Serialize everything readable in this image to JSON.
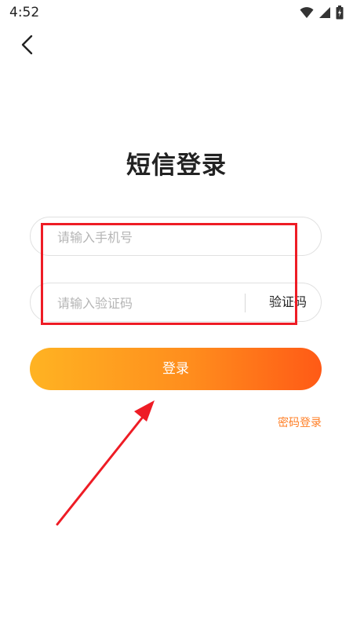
{
  "status_bar": {
    "time": "4:52",
    "icons": [
      "wifi-icon",
      "signal-icon",
      "battery-icon"
    ]
  },
  "header": {
    "back_icon": "chevron-left-icon"
  },
  "page": {
    "title": "短信登录"
  },
  "form": {
    "phone_placeholder": "请输入手机号",
    "phone_value": "",
    "code_placeholder": "请输入验证码",
    "code_value": "",
    "code_button_label": "验证码",
    "submit_label": "登录"
  },
  "links": {
    "password_login": "密码登录"
  },
  "colors": {
    "accent_start": "#ffb322",
    "accent_end": "#ff5a16",
    "link": "#ff7f26",
    "annotation_red": "#ee1c25"
  }
}
